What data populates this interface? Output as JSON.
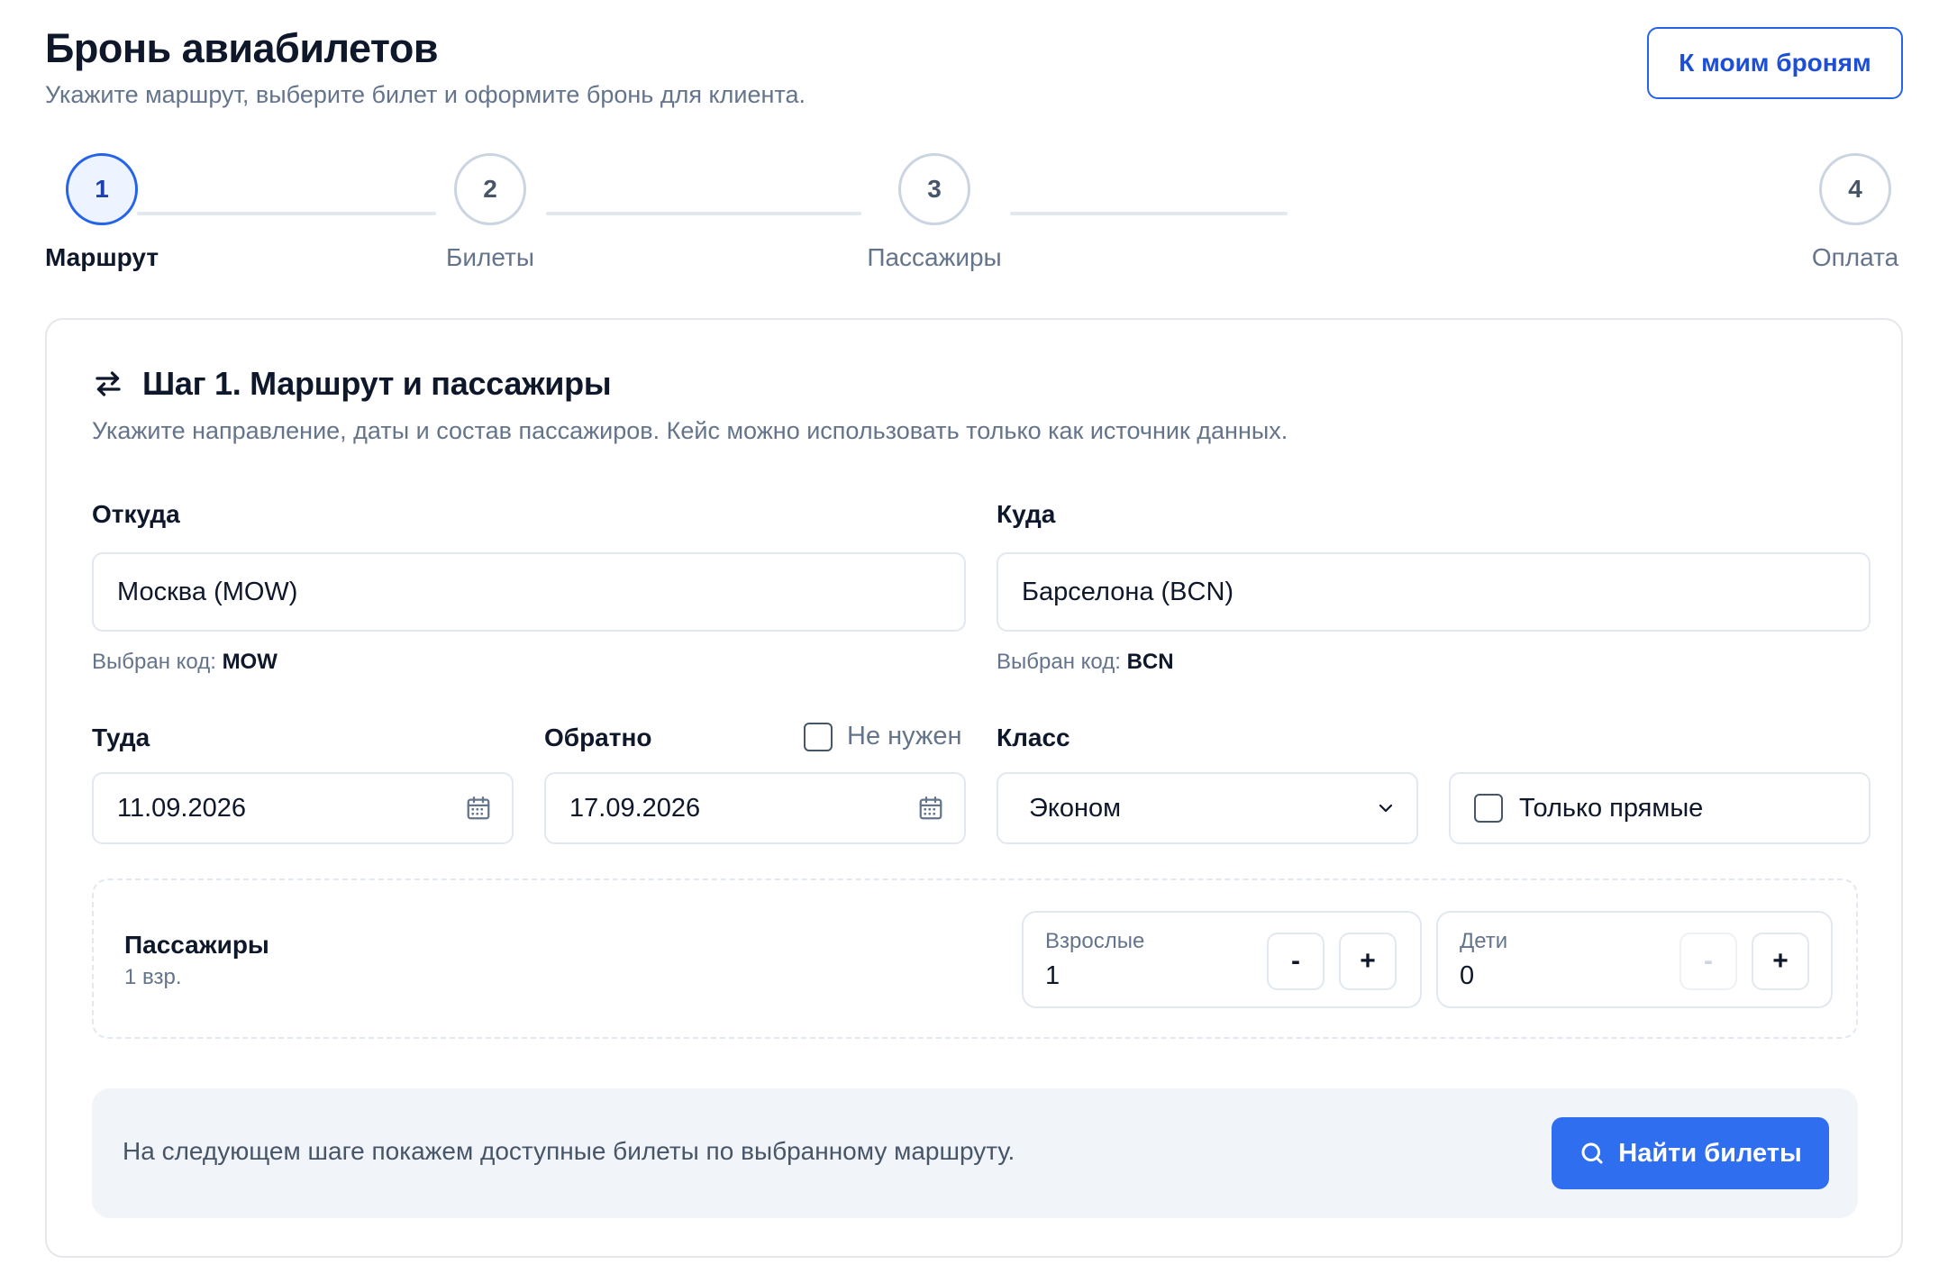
{
  "header": {
    "title": "Бронь авиабилетов",
    "subtitle": "Укажите маршрут, выберите билет и оформите бронь для клиента.",
    "my_bookings_label": "К моим броням"
  },
  "stepper": {
    "steps": [
      {
        "number": "1",
        "label": "Маршрут",
        "active": true
      },
      {
        "number": "2",
        "label": "Билеты",
        "active": false
      },
      {
        "number": "3",
        "label": "Пассажиры",
        "active": false
      },
      {
        "number": "4",
        "label": "Оплата",
        "active": false
      }
    ]
  },
  "card": {
    "title": "Шаг 1. Маршрут и пассажиры",
    "subtitle": "Укажите направление, даты и состав пассажиров. Кейс можно использовать только как источник данных.",
    "title_icon": "swap-arrows-icon"
  },
  "route": {
    "from_label": "Откуда",
    "from_value": "Москва (MOW)",
    "from_hint_prefix": "Выбран код:",
    "from_code": "MOW",
    "to_label": "Куда",
    "to_value": "Барселона (BCN)",
    "to_hint_prefix": "Выбран код:",
    "to_code": "BCN"
  },
  "dates": {
    "depart_label": "Туда",
    "depart_value": "11.09.2026",
    "return_label": "Обратно",
    "return_value": "17.09.2026",
    "no_return_label": "Не нужен",
    "no_return_checked": false
  },
  "class": {
    "label": "Класс",
    "value": "Эконом",
    "direct_only_label": "Только прямые",
    "direct_only_checked": false
  },
  "passengers": {
    "title": "Пассажиры",
    "summary": "1 взр.",
    "adults_label": "Взрослые",
    "adults_value": "1",
    "children_label": "Дети",
    "children_value": "0",
    "minus": "-",
    "plus": "+"
  },
  "footer": {
    "note": "На следующем шаге покажем доступные билеты по выбранному маршруту.",
    "search_label": "Найти билеты"
  },
  "colors": {
    "accent": "#2f6fef",
    "active_step_border": "#2563eb",
    "muted_text": "#64748b",
    "border": "#e2e8f0"
  }
}
